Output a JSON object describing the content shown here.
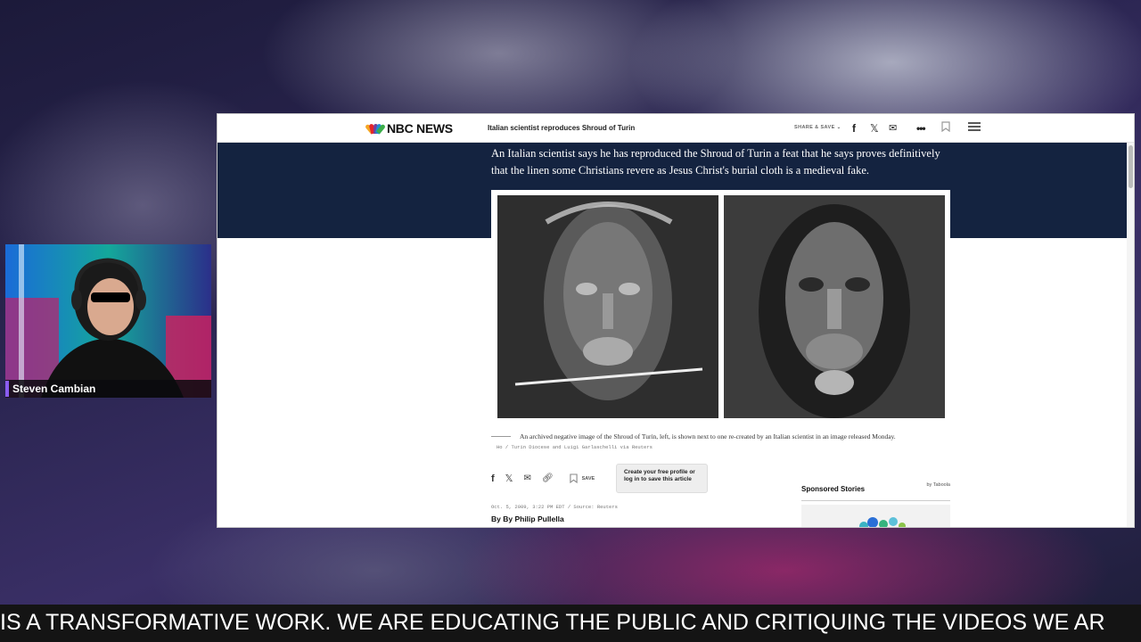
{
  "browser": {
    "topbar": {
      "logo_text": "NBC NEWS",
      "headline": "Italian scientist reproduces Shroud of Turin",
      "share_label": "SHARE & SAVE",
      "share_chevron": "⌄",
      "icons": [
        "facebook-icon",
        "x-icon",
        "mail-icon",
        "more-icon",
        "bookmark-icon",
        "menu-icon"
      ]
    },
    "article": {
      "lead": "An Italian scientist says he has reproduced the Shroud of Turin a feat that he says proves definitively that the linen some Christians revere as Jesus Christ's burial cloth is a medieval fake.",
      "caption": "An archived negative image of the Shroud of Turin, left, is shown next to one re-created by an Italian scientist in an image released Monday.",
      "credit": "Ho / Turin Diocese and Luigi Garlaschelli via Reuters",
      "save_label": "SAVE",
      "tooltip": "Create your free profile or log in to save this article",
      "dateline": "Oct. 5, 2009, 3:22 PM EDT / Source: Reuters",
      "byline": "By By Philip Pullella"
    },
    "sidebar": {
      "sponsored_title": "Sponsored Stories",
      "sponsored_by": "by Taboola"
    }
  },
  "stream": {
    "streamer_name": "Steven Cambian",
    "ticker": "IS A TRANSFORMATIVE WORK. WE ARE EDUCATING THE PUBLIC AND CRITIQUING THE VIDEOS WE AR"
  },
  "colors": {
    "navy_band": "#142340",
    "name_accent": "#8a5cf0",
    "ticker_bg": "#141414"
  }
}
